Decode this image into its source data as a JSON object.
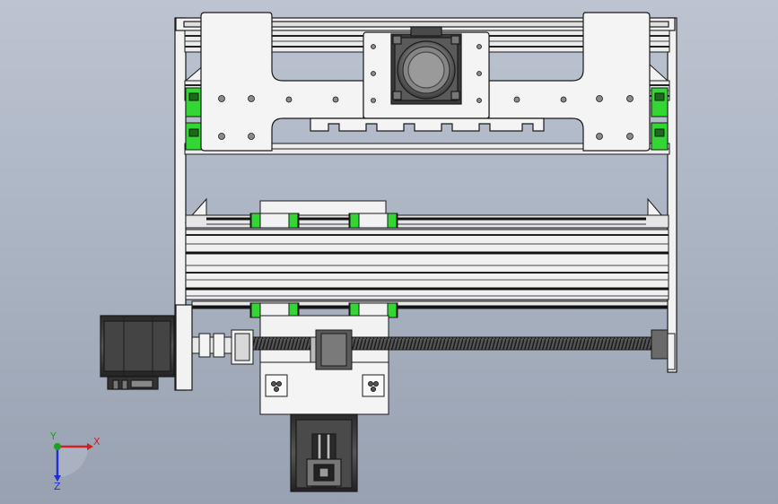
{
  "triad": {
    "x_label": "X",
    "y_label": "Y",
    "z_label": "Z",
    "x_color": "#d02020",
    "y_color": "#20a020",
    "z_color": "#2030d0"
  },
  "colors": {
    "background_top": "#bcc4d1",
    "background_bottom": "#98a1b1",
    "part_white": "#f2f2f2",
    "edge": "#1a1a1a",
    "rail": "#2a2a2a",
    "carriage_green": "#33d633",
    "motor_dark": "#3c3c3c",
    "motor_face": "#7a7a7a"
  }
}
